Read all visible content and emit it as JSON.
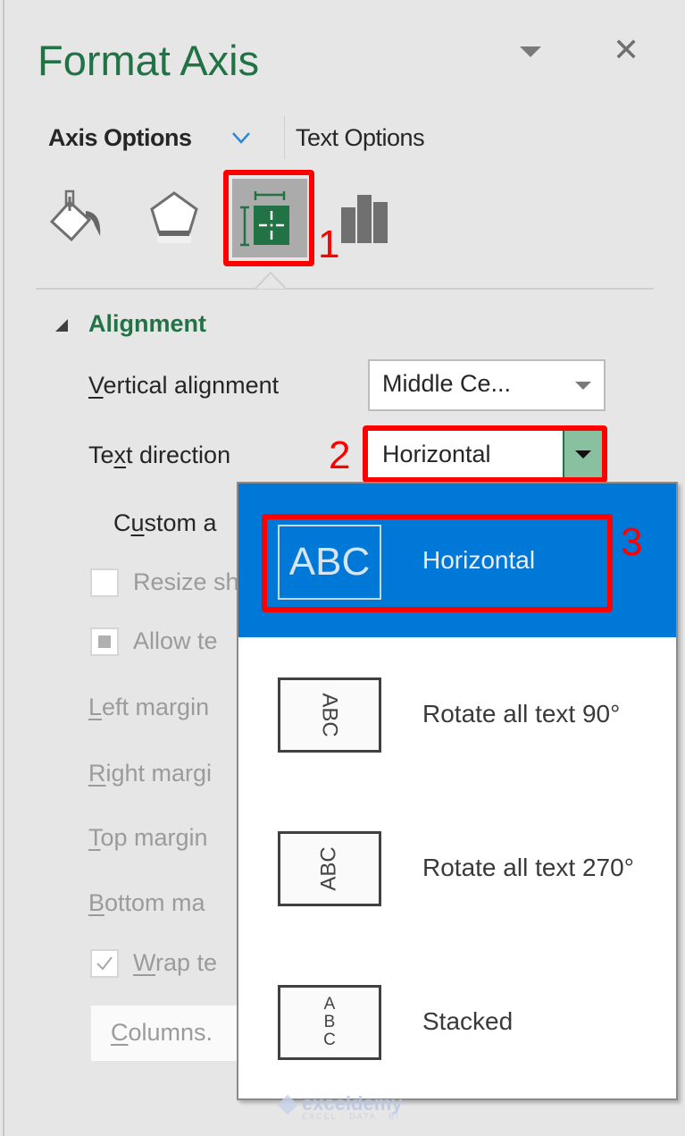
{
  "pane": {
    "title": "Format Axis",
    "menu_icon": "pane-options-triangle-icon",
    "close_icon": "close-x-icon"
  },
  "tabs": [
    {
      "label": "Axis Options",
      "active": true,
      "icon": "chevron-down-icon"
    },
    {
      "label": "Text Options",
      "active": false
    }
  ],
  "icon_tabs": [
    {
      "name": "Fill & Line",
      "icon": "paint-bucket-icon",
      "selected": false
    },
    {
      "name": "Effects",
      "icon": "pentagon-effects-icon",
      "selected": false
    },
    {
      "name": "Size & Properties",
      "icon": "size-properties-icon",
      "selected": true
    },
    {
      "name": "Axis Options",
      "icon": "bar-chart-icon",
      "selected": false
    }
  ],
  "annotations": {
    "step1": "1",
    "step2": "2",
    "step3": "3",
    "highlight_color": "#ff0000"
  },
  "section": {
    "title": "Alignment",
    "expanded": true
  },
  "fields": {
    "vertical_alignment": {
      "label_u": "V",
      "label_rest": "ertical alignment",
      "value": "Middle Ce..."
    },
    "text_direction": {
      "label_pre": "Te",
      "label_u": "x",
      "label_post": "t direction",
      "value": "Horizontal"
    },
    "custom_angle": {
      "label_pre": "C",
      "label_u": "u",
      "label_post": "stom a"
    },
    "resize_shape": {
      "label": "Resize sh",
      "checked": false
    },
    "allow_text": {
      "label": "Allow te",
      "state": "indeterminate"
    },
    "left_margin": {
      "label_u": "L",
      "label_rest": "eft margin"
    },
    "right_margin": {
      "label_u": "R",
      "label_rest": "ight margi"
    },
    "top_margin": {
      "label_u": "T",
      "label_rest": "op margin"
    },
    "bottom_margin": {
      "label_u": "B",
      "label_rest": "ottom ma"
    },
    "wrap_text": {
      "label_u": "W",
      "label_rest": "rap te",
      "checked": true
    },
    "columns_button": {
      "label_u": "C",
      "label_rest": "olumns."
    }
  },
  "text_direction_menu": {
    "options": [
      {
        "label": "Horizontal",
        "preview": "ABC",
        "selected": true
      },
      {
        "label": "Rotate all text 90°",
        "preview": "ABC",
        "selected": false
      },
      {
        "label": "Rotate all text 270°",
        "preview": "ABC",
        "selected": false
      },
      {
        "label": "Stacked",
        "preview": "ABC",
        "selected": false
      }
    ],
    "stacked_letters": [
      "A",
      "B",
      "C"
    ]
  },
  "watermark": {
    "brand": "exceldemy",
    "tagline": "EXCEL · DATA · BI"
  },
  "colors": {
    "accent_green": "#217346",
    "selection_blue": "#0078d7",
    "dropdown_button_green": "#88c0a0"
  }
}
